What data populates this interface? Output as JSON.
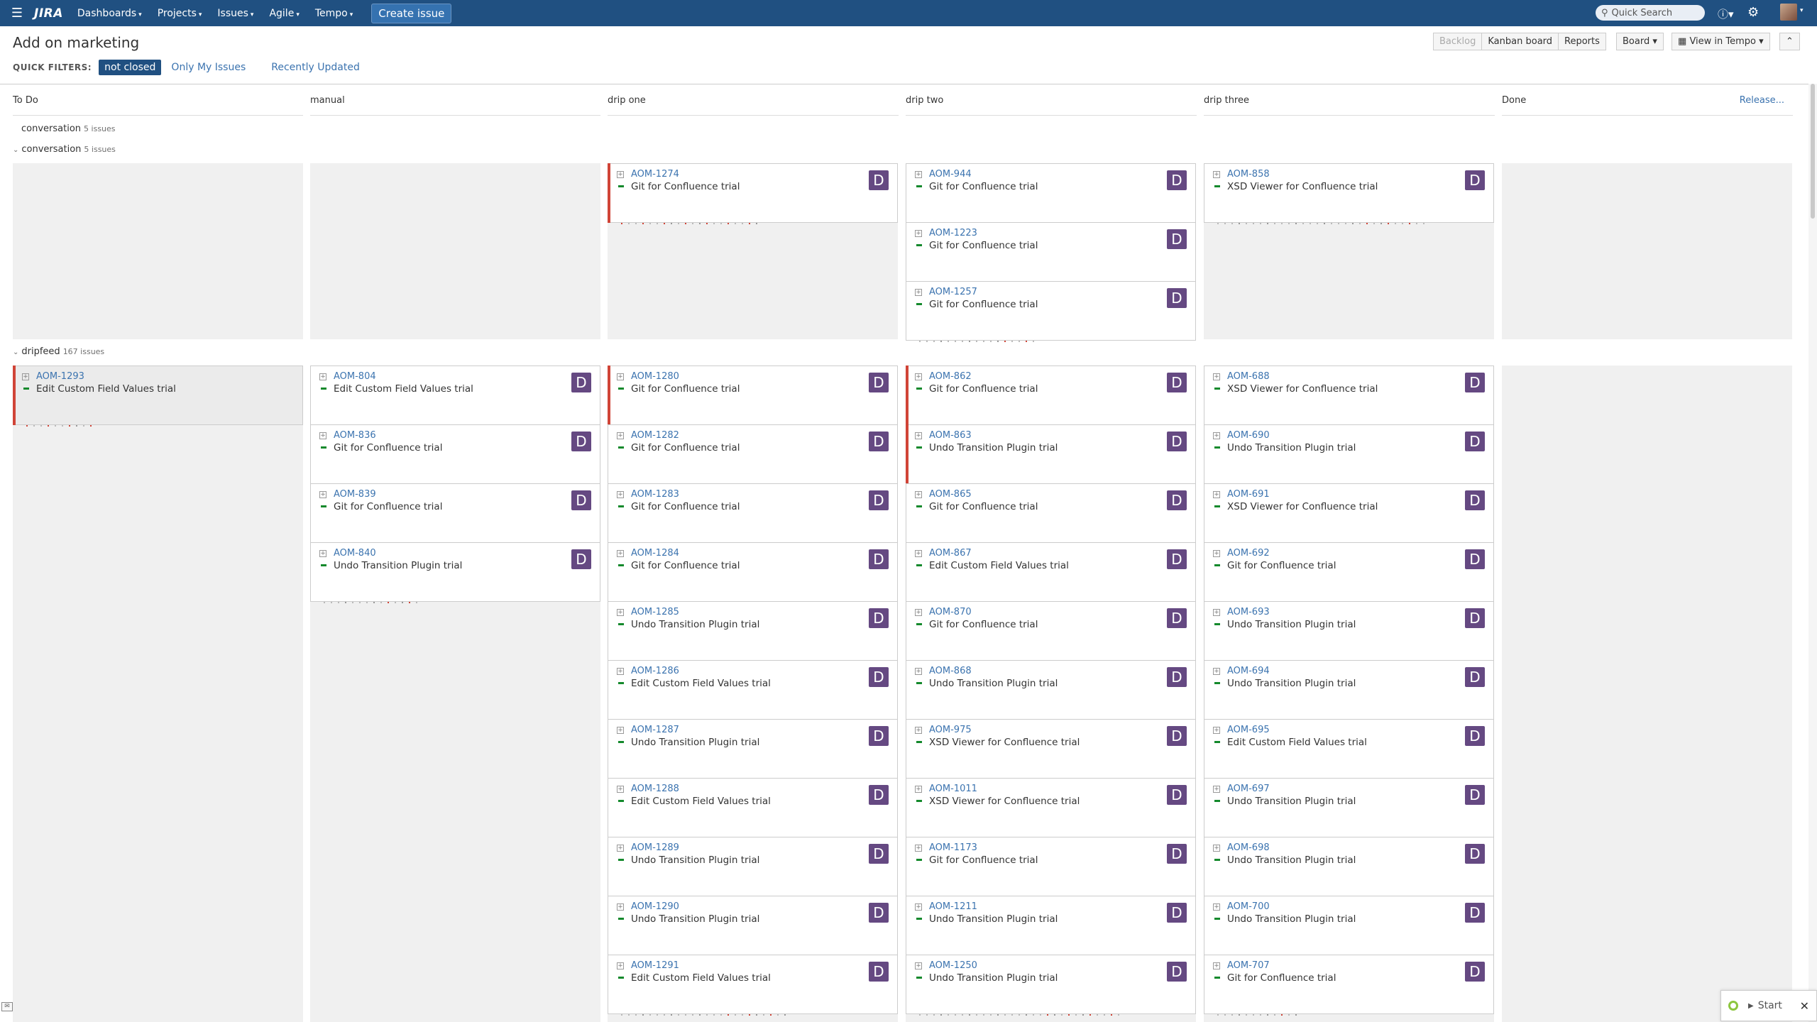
{
  "header": {
    "logo": "JIRA",
    "nav": [
      "Dashboards",
      "Projects",
      "Issues",
      "Agile",
      "Tempo"
    ],
    "create": "Create issue",
    "search_placeholder": "Quick Search"
  },
  "board": {
    "title": "Add on marketing",
    "quick_filters_label": "QUICK FILTERS:",
    "filters": [
      {
        "label": "not closed",
        "active": true
      },
      {
        "label": "Only My Issues",
        "active": false
      },
      {
        "label": "Recently Updated",
        "active": false
      }
    ],
    "tools": {
      "backlog": "Backlog",
      "kanban": "Kanban board",
      "reports": "Reports",
      "board": "Board",
      "tempo": "View in Tempo"
    },
    "columns": [
      "To Do",
      "manual",
      "drip one",
      "drip two",
      "drip three",
      "Done"
    ],
    "release": "Release...",
    "swimlanes": [
      {
        "name": "conversation",
        "count": "5 issues",
        "expanded": false
      },
      {
        "name": "conversation",
        "count": "5 issues",
        "expanded": true
      },
      {
        "name": "dripfeed",
        "count": "167 issues",
        "expanded": true
      }
    ]
  },
  "cards": {
    "conv": [
      [],
      [],
      [
        {
          "key": "AOM-1274",
          "summary": "Git for Confluence trial",
          "avatar": "D",
          "flag": true
        }
      ],
      [
        {
          "key": "AOM-944",
          "summary": "Git for Confluence trial",
          "avatar": "D",
          "flag": false
        },
        {
          "key": "AOM-1223",
          "summary": "Git for Confluence trial",
          "avatar": "D",
          "flag": false
        },
        {
          "key": "AOM-1257",
          "summary": "Git for Confluence trial",
          "avatar": "D",
          "flag": false
        }
      ],
      [
        {
          "key": "AOM-858",
          "summary": "XSD Viewer for Confluence trial",
          "avatar": "D",
          "flag": false
        }
      ],
      []
    ],
    "drip": [
      [
        {
          "key": "AOM-1293",
          "summary": "Edit Custom Field Values trial",
          "avatar": "",
          "flag": true,
          "grey": true
        }
      ],
      [
        {
          "key": "AOM-804",
          "summary": "Edit Custom Field Values trial",
          "avatar": "D",
          "flag": false
        },
        {
          "key": "AOM-836",
          "summary": "Git for Confluence trial",
          "avatar": "D",
          "flag": false
        },
        {
          "key": "AOM-839",
          "summary": "Git for Confluence trial",
          "avatar": "D",
          "flag": false
        },
        {
          "key": "AOM-840",
          "summary": "Undo Transition Plugin trial",
          "avatar": "D",
          "flag": false
        }
      ],
      [
        {
          "key": "AOM-1280",
          "summary": "Git for Confluence trial",
          "avatar": "D",
          "flag": true
        },
        {
          "key": "AOM-1282",
          "summary": "Git for Confluence trial",
          "avatar": "D",
          "flag": false
        },
        {
          "key": "AOM-1283",
          "summary": "Git for Confluence trial",
          "avatar": "D",
          "flag": false
        },
        {
          "key": "AOM-1284",
          "summary": "Git for Confluence trial",
          "avatar": "D",
          "flag": false
        },
        {
          "key": "AOM-1285",
          "summary": "Undo Transition Plugin trial",
          "avatar": "D",
          "flag": false
        },
        {
          "key": "AOM-1286",
          "summary": "Edit Custom Field Values trial",
          "avatar": "D",
          "flag": false
        },
        {
          "key": "AOM-1287",
          "summary": "Undo Transition Plugin trial",
          "avatar": "D",
          "flag": false
        },
        {
          "key": "AOM-1288",
          "summary": "Edit Custom Field Values trial",
          "avatar": "D",
          "flag": false
        },
        {
          "key": "AOM-1289",
          "summary": "Undo Transition Plugin trial",
          "avatar": "D",
          "flag": false
        },
        {
          "key": "AOM-1290",
          "summary": "Undo Transition Plugin trial",
          "avatar": "D",
          "flag": false
        },
        {
          "key": "AOM-1291",
          "summary": "Edit Custom Field Values trial",
          "avatar": "D",
          "flag": false
        }
      ],
      [
        {
          "key": "AOM-862",
          "summary": "Git for Confluence trial",
          "avatar": "D",
          "flag": true
        },
        {
          "key": "AOM-863",
          "summary": "Undo Transition Plugin trial",
          "avatar": "D",
          "flag": true
        },
        {
          "key": "AOM-865",
          "summary": "Git for Confluence trial",
          "avatar": "D",
          "flag": false
        },
        {
          "key": "AOM-867",
          "summary": "Edit Custom Field Values trial",
          "avatar": "D",
          "flag": false
        },
        {
          "key": "AOM-870",
          "summary": "Git for Confluence trial",
          "avatar": "D",
          "flag": false
        },
        {
          "key": "AOM-868",
          "summary": "Undo Transition Plugin trial",
          "avatar": "D",
          "flag": false
        },
        {
          "key": "AOM-975",
          "summary": "XSD Viewer for Confluence trial",
          "avatar": "D",
          "flag": false
        },
        {
          "key": "AOM-1011",
          "summary": "XSD Viewer for Confluence trial",
          "avatar": "D",
          "flag": false
        },
        {
          "key": "AOM-1173",
          "summary": "Git for Confluence trial",
          "avatar": "D",
          "flag": false
        },
        {
          "key": "AOM-1211",
          "summary": "Undo Transition Plugin trial",
          "avatar": "D",
          "flag": false
        },
        {
          "key": "AOM-1250",
          "summary": "Undo Transition Plugin trial",
          "avatar": "D",
          "flag": false
        }
      ],
      [
        {
          "key": "AOM-688",
          "summary": "XSD Viewer for Confluence trial",
          "avatar": "D",
          "flag": false
        },
        {
          "key": "AOM-690",
          "summary": "Undo Transition Plugin trial",
          "avatar": "D",
          "flag": false
        },
        {
          "key": "AOM-691",
          "summary": "XSD Viewer for Confluence trial",
          "avatar": "D",
          "flag": false
        },
        {
          "key": "AOM-692",
          "summary": "Git for Confluence trial",
          "avatar": "D",
          "flag": false
        },
        {
          "key": "AOM-693",
          "summary": "Undo Transition Plugin trial",
          "avatar": "D",
          "flag": false
        },
        {
          "key": "AOM-694",
          "summary": "Undo Transition Plugin trial",
          "avatar": "D",
          "flag": false
        },
        {
          "key": "AOM-695",
          "summary": "Edit Custom Field Values trial",
          "avatar": "D",
          "flag": false
        },
        {
          "key": "AOM-697",
          "summary": "Undo Transition Plugin trial",
          "avatar": "D",
          "flag": false
        },
        {
          "key": "AOM-698",
          "summary": "Undo Transition Plugin trial",
          "avatar": "D",
          "flag": false
        },
        {
          "key": "AOM-700",
          "summary": "Undo Transition Plugin trial",
          "avatar": "D",
          "flag": false
        },
        {
          "key": "AOM-707",
          "summary": "Git for Confluence trial",
          "avatar": "D",
          "flag": false
        }
      ],
      []
    ]
  },
  "start_widget": {
    "label": "Start"
  },
  "colors": {
    "header": "#205081",
    "link": "#3b73af",
    "avatar": "#654982",
    "flag": "#d04437",
    "priority": "#14892c"
  }
}
